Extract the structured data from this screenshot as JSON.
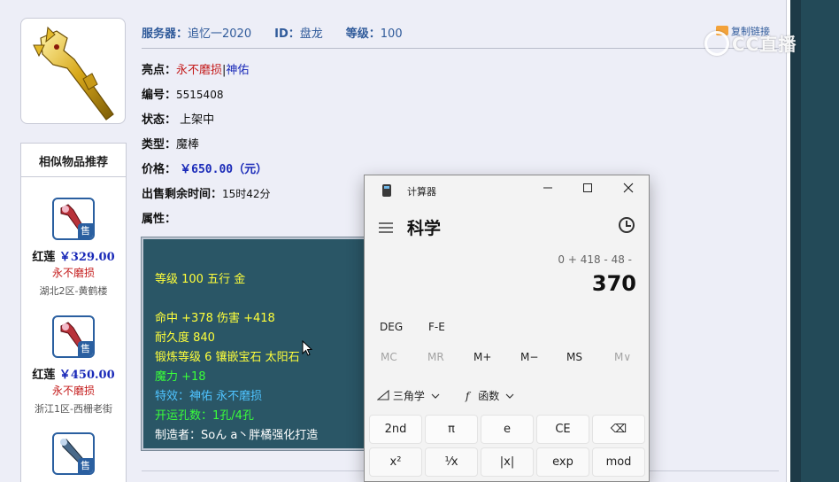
{
  "header": {
    "server_label": "服务器：",
    "server_value": "追忆一2020",
    "id_label": "ID：",
    "id_value": "盘龙",
    "level_label": "等级：",
    "level_value": "100",
    "copy_link": "复制链接"
  },
  "watermark": "CC直播",
  "details": {
    "highlight_label": "亮点：",
    "highlight_red": "永不磨损",
    "highlight_sep": "|",
    "highlight_blue": "神佑",
    "number_label": "编号：",
    "number_value": "5515408",
    "status_label": "状态：",
    "status_value": "上架中",
    "type_label": "类型：",
    "type_value": "魔棒",
    "price_label": "价格：",
    "price_value": "￥650.00（元）",
    "time_label": "出售剩余时间：",
    "time_value": "15时42分",
    "attr_label": "属性："
  },
  "attributes": {
    "line1": "等级 100 五行 金",
    "line2": "命中 +378 伤害 +418",
    "line3": "耐久度 840",
    "line4": "锻炼等级 6 镶嵌宝石 太阳石",
    "line5": "魔力 +18",
    "line6": "特效：神佑 永不磨损",
    "line7": "开运孔数：1孔/4孔",
    "line8": "制造者：Soん a丶胖橘强化打造",
    "colors": {
      "yellow": "#ffff3a",
      "green": "#3aff3a",
      "sky": "#4fc3ff",
      "white": "#ffffff"
    }
  },
  "similar": {
    "title": "相似物品推荐",
    "items": [
      {
        "name": "红莲",
        "price": "￥329.00",
        "tag": "永不磨损",
        "server": "湖北2区-黄鹤楼",
        "badge": "售"
      },
      {
        "name": "红莲",
        "price": "￥450.00",
        "tag": "永不磨损",
        "server": "浙江1区-西栅老街",
        "badge": "售"
      },
      {
        "badge": "售"
      }
    ]
  },
  "calculator": {
    "title": "计算器",
    "mode": "科学",
    "expression": "0 + 418 - 48 -",
    "result": "370",
    "deg": "DEG",
    "fe": "F-E",
    "memory": [
      "MC",
      "MR",
      "M+",
      "M−",
      "MS",
      "M∨"
    ],
    "trig": "三角学",
    "func": "函数",
    "keys_row1": [
      "2nd",
      "π",
      "e",
      "CE",
      "⌫"
    ],
    "keys_row2": [
      "x²",
      "¹⁄x",
      "|x|",
      "exp",
      "mod"
    ]
  }
}
